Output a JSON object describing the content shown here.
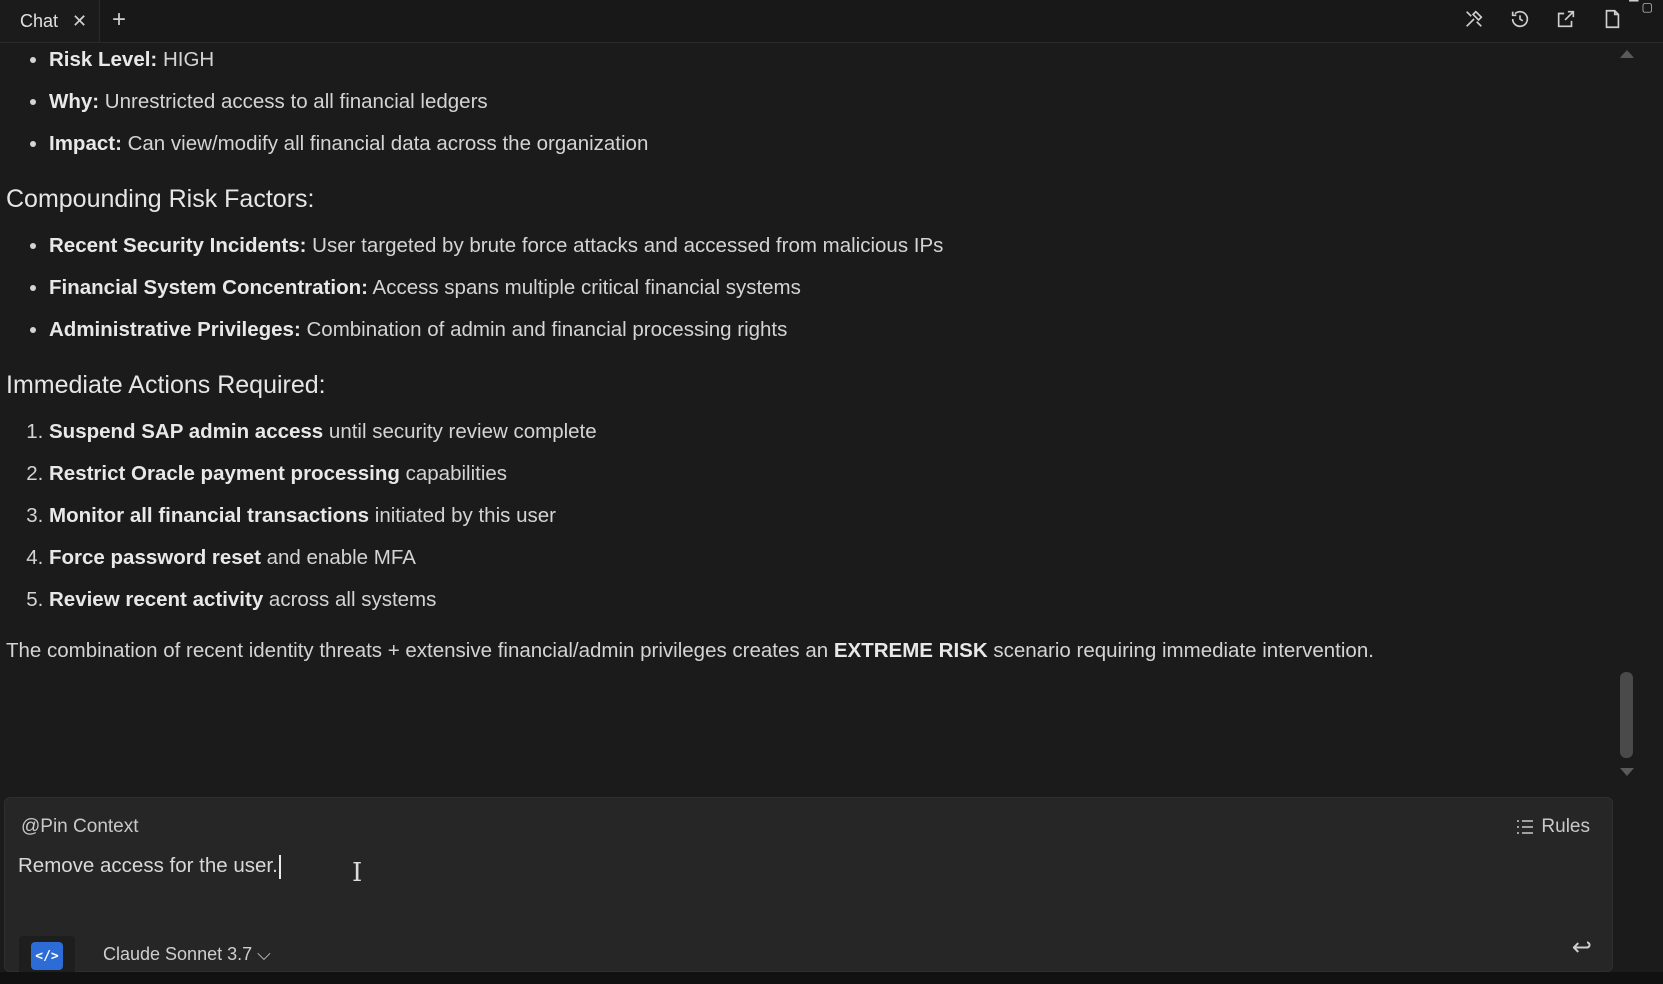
{
  "tabbar": {
    "tab_label": "Chat",
    "close_glyph": "✕",
    "add_glyph": "+",
    "icons": [
      "tools-icon",
      "history-icon",
      "open-external-icon",
      "document-icon"
    ]
  },
  "message": {
    "section1_items": [
      {
        "bold": "Risk Level:",
        "text": " HIGH"
      },
      {
        "bold": "Why:",
        "text": " Unrestricted access to all financial ledgers"
      },
      {
        "bold": "Impact:",
        "text": " Can view/modify all financial data across the organization"
      }
    ],
    "heading_compounding": "Compounding Risk Factors:",
    "compounding_items": [
      {
        "bold": "Recent Security Incidents:",
        "text": " User targeted by brute force attacks and accessed from malicious IPs"
      },
      {
        "bold": "Financial System Concentration:",
        "text": " Access spans multiple critical financial systems"
      },
      {
        "bold": "Administrative Privileges:",
        "text": " Combination of admin and financial processing rights"
      }
    ],
    "heading_actions": "Immediate Actions Required:",
    "action_items": [
      {
        "bold": "Suspend SAP admin access",
        "text": " until security review complete"
      },
      {
        "bold": "Restrict Oracle payment processing",
        "text": " capabilities"
      },
      {
        "bold": "Monitor all financial transactions",
        "text": " initiated by this user"
      },
      {
        "bold": "Force password reset",
        "text": " and enable MFA"
      },
      {
        "bold": "Review recent activity",
        "text": " across all systems"
      }
    ],
    "summary_pre": "The combination of recent identity threats + extensive financial/admin privileges creates an ",
    "summary_bold": "EXTREME RISK",
    "summary_post": " scenario requiring immediate intervention."
  },
  "composer": {
    "pin_context": "@Pin Context",
    "rules": "Rules",
    "input_value": "Remove access for the user.",
    "model_icon_glyph": "</>",
    "model_name": "Claude Sonnet 3.7",
    "model_chevron": "⌵",
    "enter_glyph": "↩"
  }
}
